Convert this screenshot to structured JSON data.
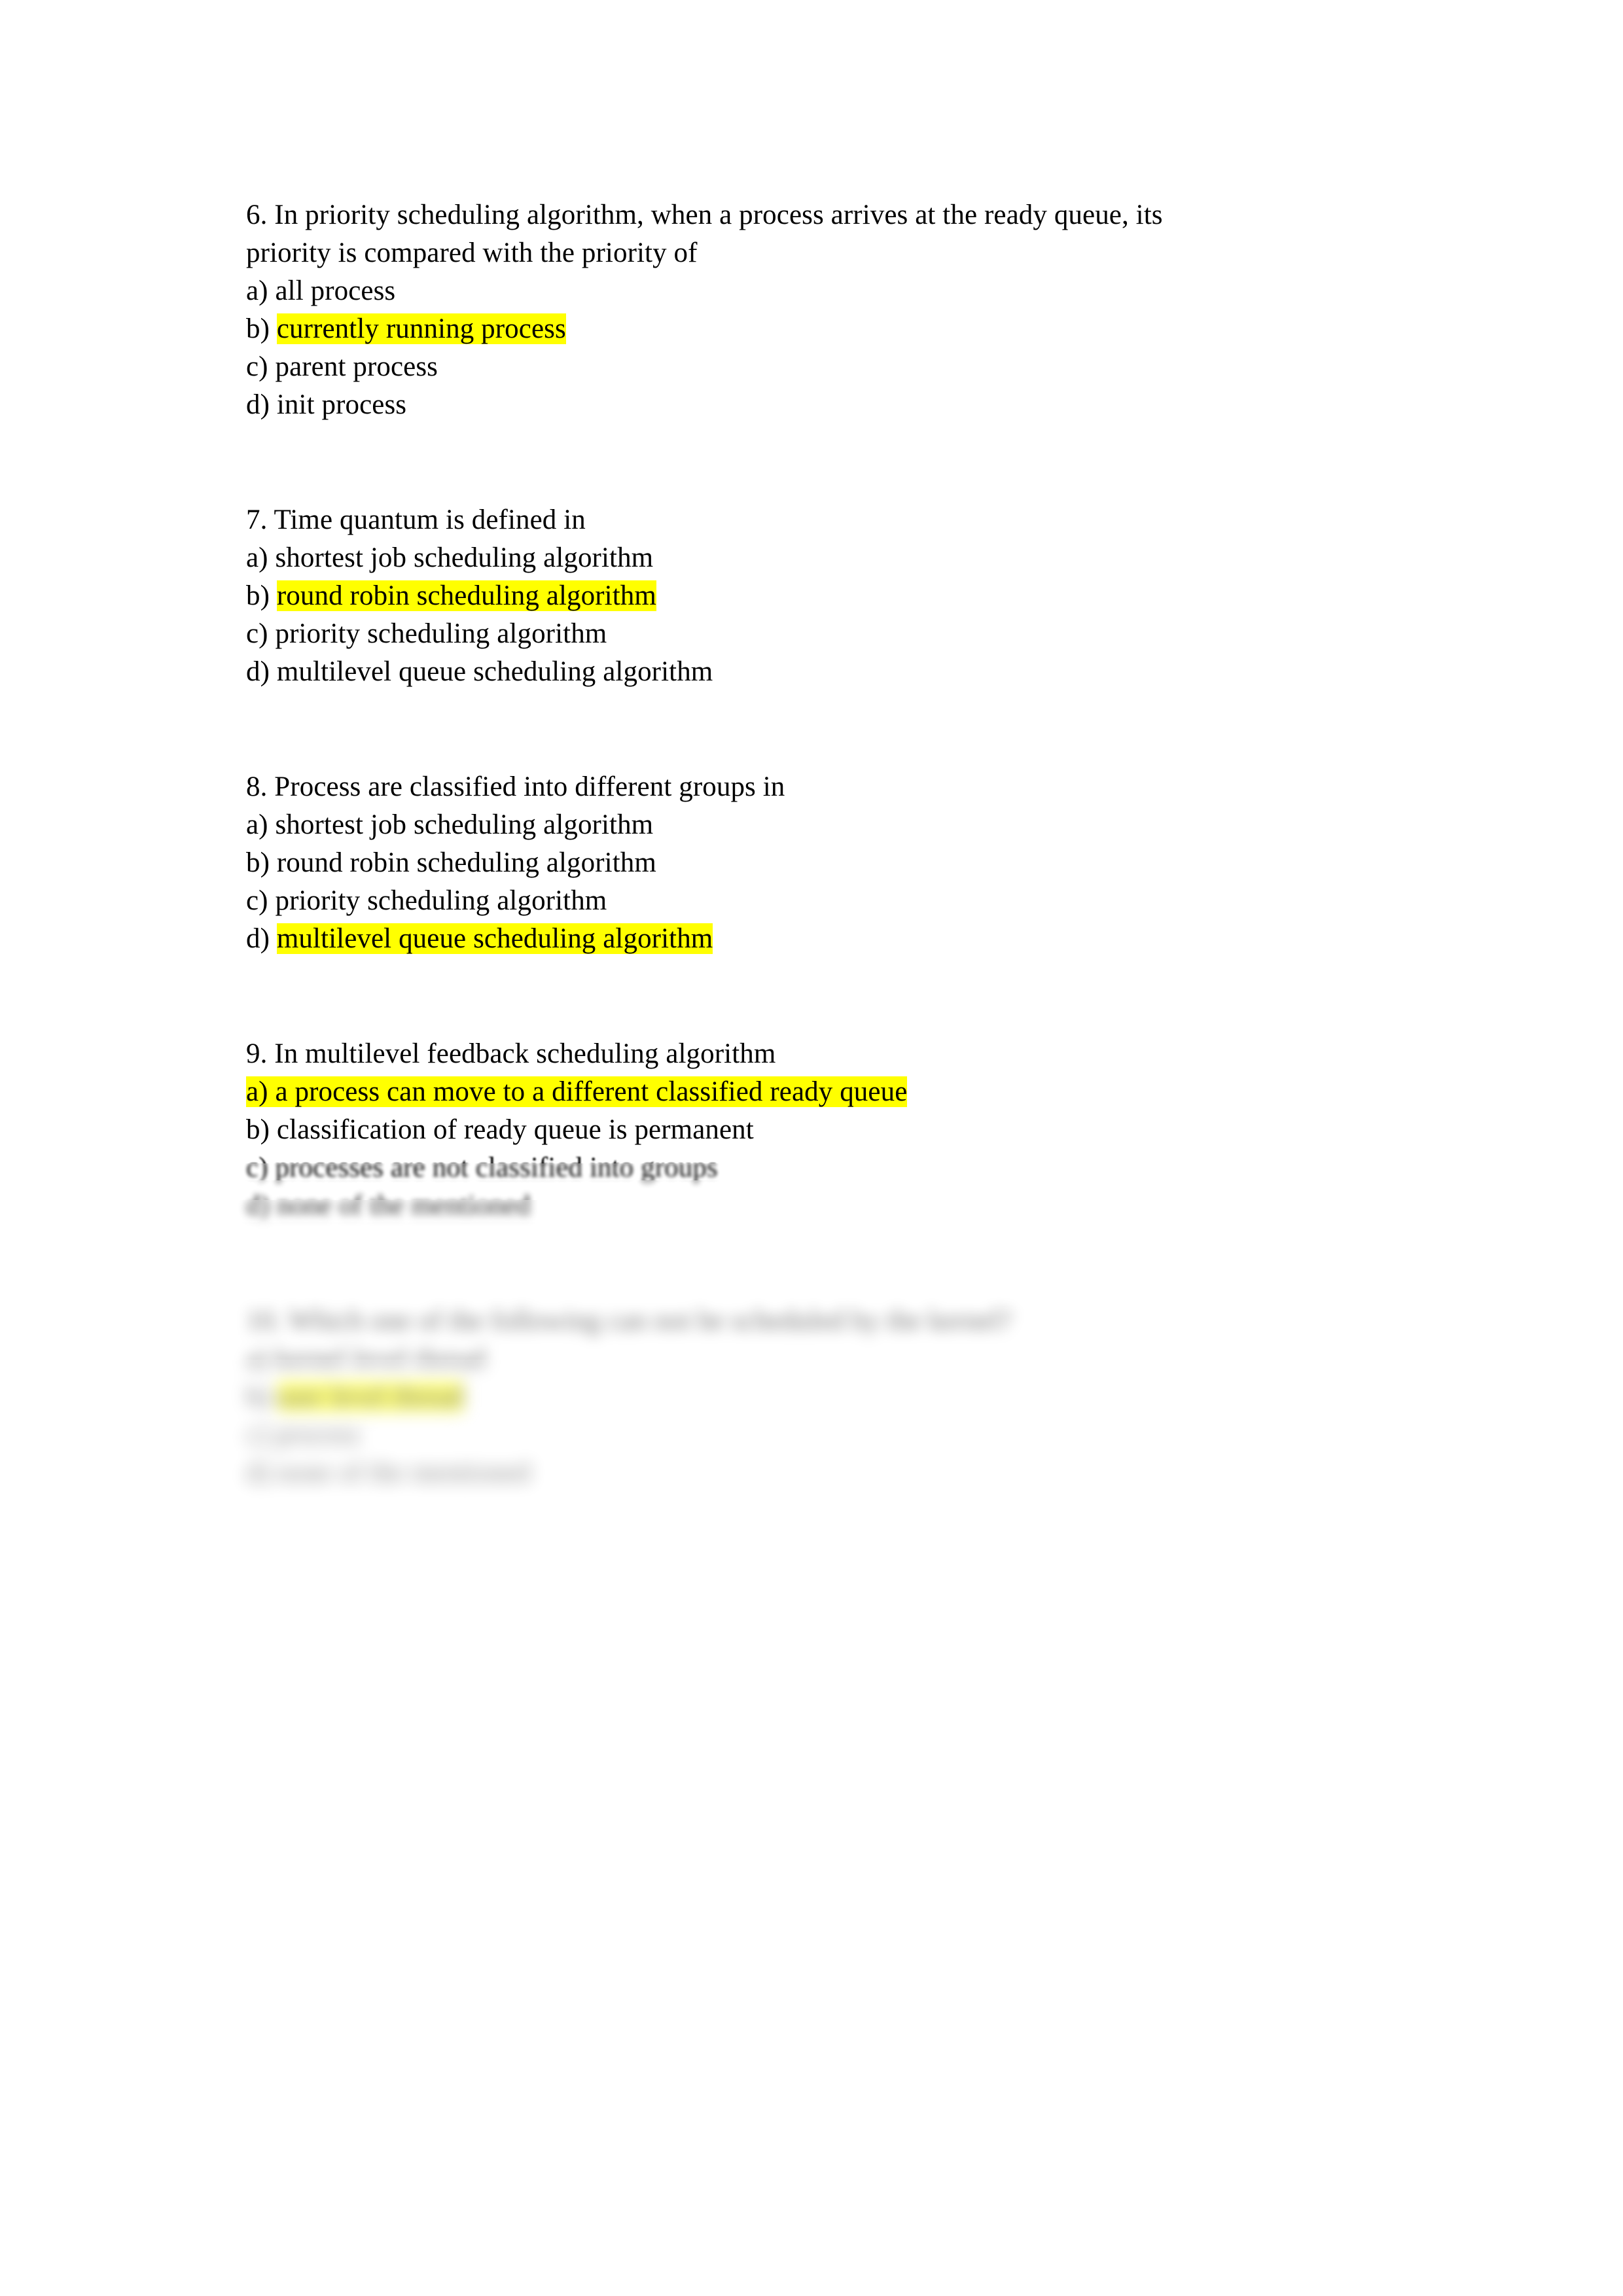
{
  "document": {
    "kind": "multiple-choice-quiz-page",
    "subject_hint": "operating system process scheduling",
    "background_color": "#ffffff",
    "text_color": "#000000",
    "highlight_color": "#ffff00"
  },
  "questions": [
    {
      "number": "6.",
      "stem_lines": [
        "6. In priority scheduling algorithm, when a process arrives at the ready queue, its",
        "priority is compared with the priority of"
      ],
      "options": [
        {
          "prefix": "a) ",
          "text": "all process",
          "highlighted": false,
          "prefix_highlighted": false
        },
        {
          "prefix": "b) ",
          "text": "currently running process",
          "highlighted": true,
          "prefix_highlighted": false
        },
        {
          "prefix": "c) ",
          "text": "parent process",
          "highlighted": false,
          "prefix_highlighted": false
        },
        {
          "prefix": "d) ",
          "text": "init process",
          "highlighted": false,
          "prefix_highlighted": false
        }
      ]
    },
    {
      "number": "7.",
      "stem_lines": [
        "7. Time quantum is defined in"
      ],
      "options": [
        {
          "prefix": "a) ",
          "text": "shortest job scheduling algorithm",
          "highlighted": false,
          "prefix_highlighted": false
        },
        {
          "prefix": "b) ",
          "text": "round robin scheduling algorithm",
          "highlighted": true,
          "prefix_highlighted": false
        },
        {
          "prefix": "c) ",
          "text": "priority scheduling algorithm",
          "highlighted": false,
          "prefix_highlighted": false
        },
        {
          "prefix": "d) ",
          "text": "multilevel queue scheduling algorithm",
          "highlighted": false,
          "prefix_highlighted": false
        }
      ]
    },
    {
      "number": "8.",
      "stem_lines": [
        "8. Process are classified into different groups in"
      ],
      "options": [
        {
          "prefix": "a) ",
          "text": "shortest job scheduling algorithm",
          "highlighted": false,
          "prefix_highlighted": false
        },
        {
          "prefix": "b) ",
          "text": "round robin scheduling algorithm",
          "highlighted": false,
          "prefix_highlighted": false
        },
        {
          "prefix": "c) ",
          "text": "priority scheduling algorithm",
          "highlighted": false,
          "prefix_highlighted": false
        },
        {
          "prefix": "d) ",
          "text": "multilevel queue scheduling algorithm",
          "highlighted": true,
          "prefix_highlighted": false
        }
      ]
    },
    {
      "number": "9.",
      "stem_lines": [
        "9. In multilevel feedback scheduling algorithm"
      ],
      "options": [
        {
          "prefix": "",
          "text": "a) a process can move to a different classified ready queue",
          "highlighted": true,
          "prefix_highlighted": true
        },
        {
          "prefix": "b) ",
          "text": "classification of ready queue is permanent",
          "highlighted": false,
          "prefix_highlighted": false
        },
        {
          "prefix": "c) ",
          "text": "processes are not classified into groups",
          "highlighted": false,
          "prefix_highlighted": false
        },
        {
          "prefix": "d) ",
          "text": "none of the mentioned",
          "highlighted": false,
          "prefix_highlighted": false
        }
      ]
    },
    {
      "number": "10.",
      "stem_lines": [
        "10. Which one of the following can not be scheduled by the kernel?"
      ],
      "options": [
        {
          "prefix": "a) ",
          "text": "kernel level thread",
          "highlighted": false,
          "prefix_highlighted": false
        },
        {
          "prefix": "b) ",
          "text": "user level thread",
          "highlighted": true,
          "prefix_highlighted": false
        },
        {
          "prefix": "c) ",
          "text": "process",
          "highlighted": false,
          "prefix_highlighted": false
        },
        {
          "prefix": "d) ",
          "text": "none of the mentioned",
          "highlighted": false,
          "prefix_highlighted": false
        }
      ]
    }
  ]
}
